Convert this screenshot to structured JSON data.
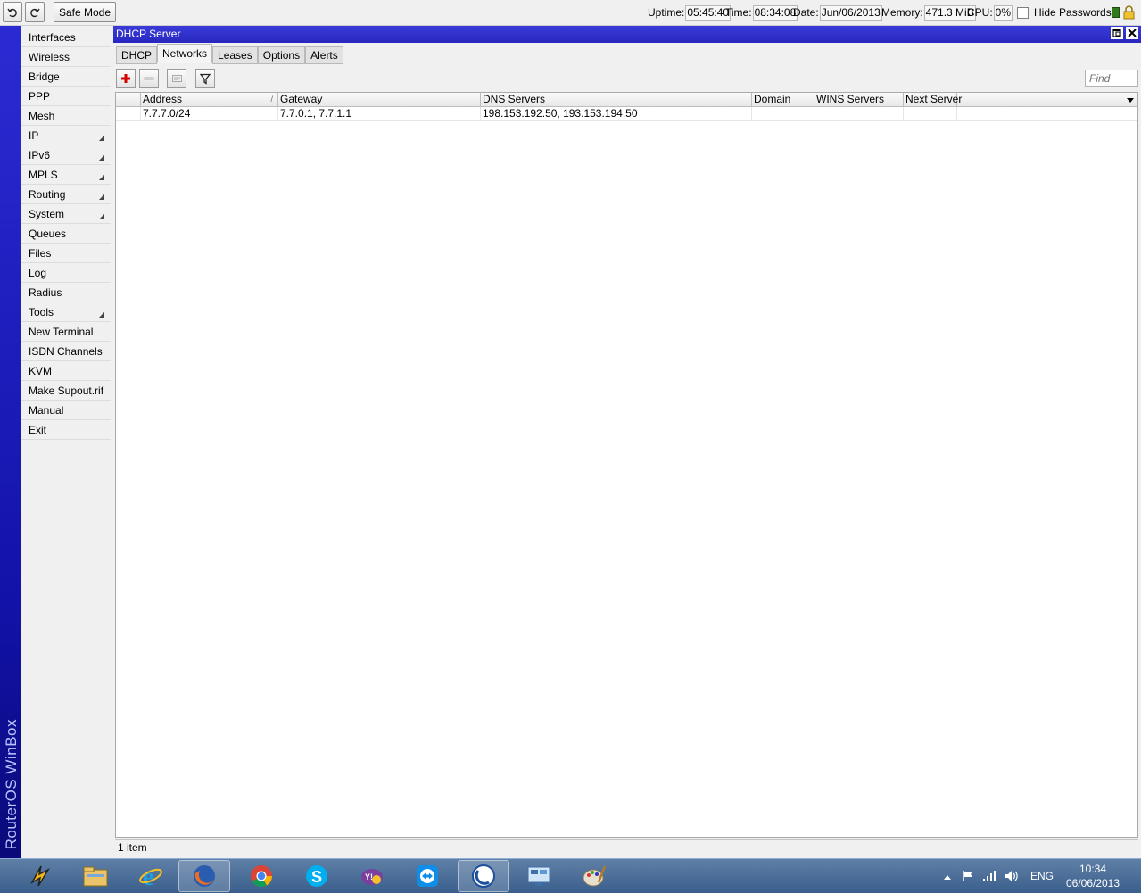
{
  "toolbar": {
    "undo_icon": "undo-icon",
    "redo_icon": "redo-icon",
    "safe_mode_label": "Safe Mode",
    "uptime_label": "Uptime:",
    "uptime_value": "05:45:40",
    "time_label": "Time:",
    "time_value": "08:34:08",
    "date_label": "Date:",
    "date_value": "Jun/06/2013",
    "memory_label": "Memory:",
    "memory_value": "471.3 MiB",
    "cpu_label": "CPU:",
    "cpu_value": "0%",
    "hide_passwords_label": "Hide Passwords"
  },
  "brand_text": "RouterOS WinBox",
  "sidebar": {
    "items": [
      {
        "label": "Interfaces",
        "submenu": false
      },
      {
        "label": "Wireless",
        "submenu": false
      },
      {
        "label": "Bridge",
        "submenu": false
      },
      {
        "label": "PPP",
        "submenu": false
      },
      {
        "label": "Mesh",
        "submenu": false
      },
      {
        "label": "IP",
        "submenu": true
      },
      {
        "label": "IPv6",
        "submenu": true
      },
      {
        "label": "MPLS",
        "submenu": true
      },
      {
        "label": "Routing",
        "submenu": true
      },
      {
        "label": "System",
        "submenu": true
      },
      {
        "label": "Queues",
        "submenu": false
      },
      {
        "label": "Files",
        "submenu": false
      },
      {
        "label": "Log",
        "submenu": false
      },
      {
        "label": "Radius",
        "submenu": false
      },
      {
        "label": "Tools",
        "submenu": true
      },
      {
        "label": "New Terminal",
        "submenu": false
      },
      {
        "label": "ISDN Channels",
        "submenu": false
      },
      {
        "label": "KVM",
        "submenu": false
      },
      {
        "label": "Make Supout.rif",
        "submenu": false
      },
      {
        "label": "Manual",
        "submenu": false
      },
      {
        "label": "Exit",
        "submenu": false
      }
    ]
  },
  "window": {
    "title": "DHCP Server",
    "tabs": [
      {
        "label": "DHCP",
        "active": false
      },
      {
        "label": "Networks",
        "active": true
      },
      {
        "label": "Leases",
        "active": false
      },
      {
        "label": "Options",
        "active": false
      },
      {
        "label": "Alerts",
        "active": false
      }
    ],
    "find_placeholder": "Find",
    "columns": [
      "Address",
      "Gateway",
      "DNS Servers",
      "Domain",
      "WINS Servers",
      "Next Server"
    ],
    "rows": [
      {
        "address": "7.7.7.0/24",
        "gateway": "7.7.0.1, 7.7.1.1",
        "dns_servers": "198.153.192.50, 193.153.194.50",
        "domain": "",
        "wins_servers": "",
        "next_server": ""
      }
    ],
    "status": "1 item"
  },
  "taskbar": {
    "apps": [
      "winamp-icon",
      "file-explorer-icon",
      "internet-explorer-icon",
      "firefox-icon",
      "chrome-icon",
      "skype-icon",
      "messenger-icon",
      "teamviewer-icon",
      "winbox-icon",
      "remote-desktop-icon",
      "paint-icon"
    ],
    "active_apps": [
      "firefox-icon",
      "winbox-icon"
    ],
    "language": "ENG",
    "clock_time": "10:34",
    "clock_date": "06/06/2013"
  },
  "colors": {
    "title_bar": "#2828c0",
    "brand_strip": "#1212a8",
    "add_icon": "#d40000",
    "taskbar": "#3a5f8c"
  }
}
